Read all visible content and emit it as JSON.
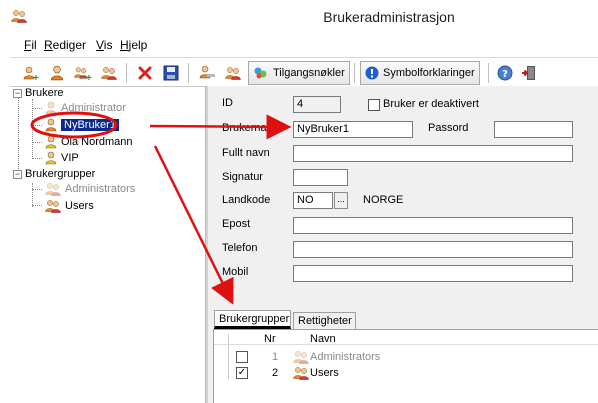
{
  "window": {
    "title": "Brukeradministrasjon"
  },
  "menu": [
    {
      "key": "F",
      "rest": "il"
    },
    {
      "key": "R",
      "rest": "ediger"
    },
    {
      "key": "V",
      "rest": "is"
    },
    {
      "key": "H",
      "rest": "jelp"
    }
  ],
  "toolbar": {
    "tilgangsnokler_label": "Tilgangsnøkler",
    "symbolforklaringer_label": "Symbolforklaringer"
  },
  "tree": {
    "brukere_label": "Brukere",
    "users": [
      "Administrator",
      "NyBruker1",
      "Ola Nordmann",
      "VIP"
    ],
    "brukergrupper_label": "Brukergrupper",
    "groups": [
      "Administrators",
      "Users"
    ]
  },
  "form": {
    "id_label": "ID",
    "id_value": "4",
    "deaktivert_label": "Bruker er deaktivert",
    "brukernavn_label": "Brukernavn",
    "brukernavn_value": "NyBruker1",
    "passord_label": "Passord",
    "fullt_navn_label": "Fullt navn",
    "signatur_label": "Signatur",
    "landkode_label": "Landkode",
    "landkode_value": "NO",
    "landkode_button": "...",
    "landkode_name": "NORGE",
    "epost_label": "Epost",
    "telefon_label": "Telefon",
    "mobil_label": "Mobil"
  },
  "tabs": {
    "brukergrupper": "Brukergrupper",
    "rettigheter": "Rettigheter",
    "grid": {
      "col_nr": "Nr",
      "col_navn": "Navn",
      "rows": [
        {
          "nr": "1",
          "navn": "Administrators",
          "checked": false
        },
        {
          "nr": "2",
          "navn": "Users",
          "checked": true
        }
      ]
    }
  },
  "colors": {
    "selection": "#0b2a8f",
    "annotation_red": "#e01010"
  }
}
